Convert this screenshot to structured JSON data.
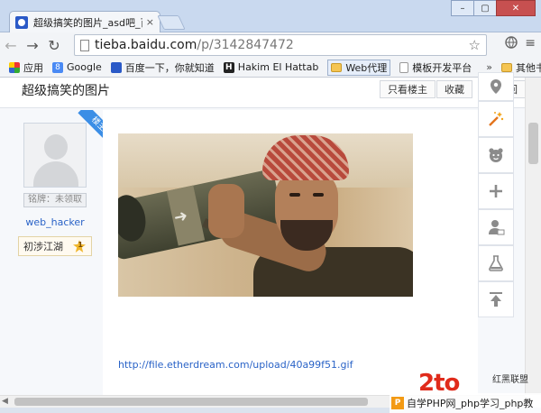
{
  "browser": {
    "tab_title": "超级搞笑的图片_asd吧_百",
    "tab_close": "×",
    "url_host": "tieba.baidu.com",
    "url_path": "/p/3142847472",
    "back": "←",
    "forward": "→",
    "reload": "↻",
    "star": "☆",
    "menu": "≡",
    "window_min": "–",
    "window_max": "▢",
    "window_close": "✕",
    "bookmarks": [
      {
        "label": "应用",
        "icon": "apps-icon"
      },
      {
        "label": "Google",
        "icon": "google-icon"
      },
      {
        "label": "百度一下，你就知道",
        "icon": "baidu-icon"
      },
      {
        "label": "Hakim El Hattab",
        "icon": "h-icon"
      },
      {
        "label": "Web代理",
        "icon": "folder-icon"
      },
      {
        "label": "模板开发平台",
        "icon": "page-icon"
      }
    ],
    "bookmarks_more": "»",
    "other_bookmarks": "其他书签"
  },
  "page": {
    "post_title": "超级搞笑的图片",
    "only_op_button": "只看楼主",
    "favorite_button": "收藏",
    "reply_button_partial": "回"
  },
  "author": {
    "ribbon": "楼主",
    "badge": "铭牌：未领取",
    "username": "web_hacker",
    "level_title": "初涉江湖",
    "level_number": "1"
  },
  "post": {
    "link": "http://file.etherdream.com/upload/40a99f51.gif"
  },
  "watermark": {
    "logo": "2to",
    "tag": "红黑联盟",
    "bar_text": "自学PHP网_php学习_php教"
  },
  "colors": {
    "accent_blue": "#2a63c7",
    "ribbon_blue": "#3b8ee6",
    "watermark_red": "#e02b1b"
  }
}
